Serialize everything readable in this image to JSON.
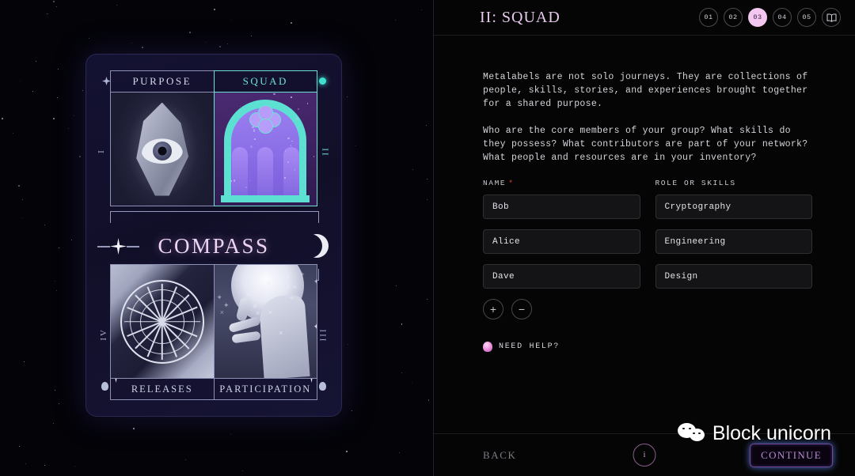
{
  "card": {
    "title": "COMPASS",
    "quadrants": [
      {
        "label": "PURPOSE",
        "numeral": "I",
        "art": "eye-crystal-icon"
      },
      {
        "label": "SQUAD",
        "numeral": "II",
        "art": "cathedral-window-icon"
      },
      {
        "label": "RELEASES",
        "numeral": "IV",
        "art": "wheel-mandala-icon"
      },
      {
        "label": "PARTICIPATION",
        "numeral": "III",
        "art": "hand-moon-icon"
      }
    ],
    "accent_teal": "#5ce0d2",
    "accent_purple": "#8468e0",
    "title_color": "#ecd6f2"
  },
  "header": {
    "title": "II: SQUAD",
    "steps": [
      {
        "label": "01",
        "active": false
      },
      {
        "label": "02",
        "active": false
      },
      {
        "label": "03",
        "active": true
      },
      {
        "label": "04",
        "active": false
      },
      {
        "label": "05",
        "active": false
      }
    ],
    "book_icon": "book-icon",
    "active_color": "#f3c7f0"
  },
  "body": {
    "paragraphs": [
      "Metalabels are not solo journeys. They are collections of people, skills, stories, and experiences brought together for a shared purpose.",
      "Who are the core members of your group? What skills do they possess? What contributors are part of your network? What people and resources are in your inventory?"
    ]
  },
  "form": {
    "columns": [
      {
        "header": "NAME",
        "required": true,
        "required_mark": "*"
      },
      {
        "header": "ROLE OR SKILLS",
        "required": false,
        "required_mark": ""
      }
    ],
    "rows": [
      {
        "name": "Bob",
        "role": "Cryptography"
      },
      {
        "name": "Alice",
        "role": "Engineering"
      },
      {
        "name": "Dave",
        "role": "Design"
      }
    ],
    "add_label": "+",
    "remove_label": "−",
    "help_label": "NEED HELP?",
    "help_icon": "crystal-ball-icon"
  },
  "footer": {
    "back_label": "BACK",
    "info_label": "i",
    "continue_label": "CONTINUE"
  },
  "watermark": {
    "text": "Block unicorn",
    "icon": "wechat-icon"
  }
}
